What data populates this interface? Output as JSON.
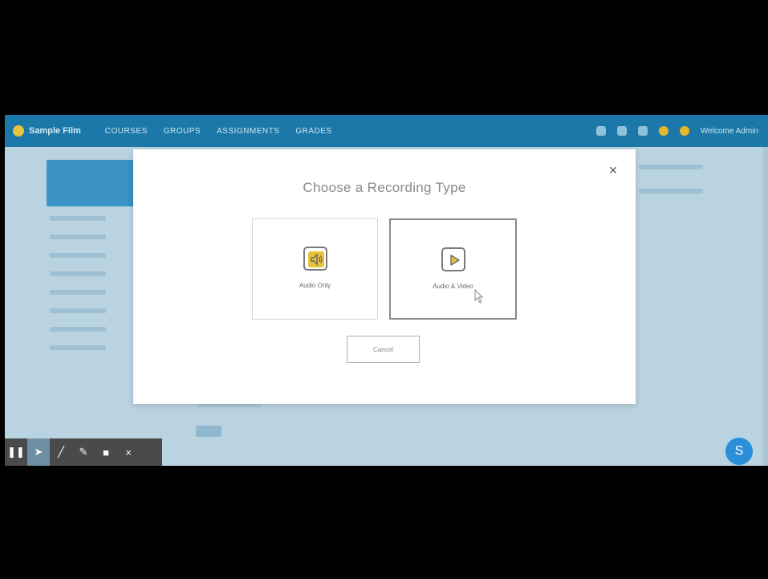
{
  "app": {
    "brand": "Sample Film",
    "nav_items": [
      "COURSES",
      "GROUPS",
      "ASSIGNMENTS",
      "GRADES"
    ],
    "user_label": "Welcome Admin"
  },
  "modal": {
    "title": "Choose a Recording Type",
    "close_symbol": "×",
    "options": [
      {
        "label": "Audio Only",
        "icon": "speaker-icon"
      },
      {
        "label": "Audio & Video",
        "icon": "play-icon"
      }
    ],
    "cancel_label": "Cancel"
  },
  "toolbar": {
    "tools": [
      {
        "name": "pause-icon",
        "glyph": "❚❚"
      },
      {
        "name": "pointer-icon",
        "glyph": "➤"
      },
      {
        "name": "pen-icon",
        "glyph": "╱"
      },
      {
        "name": "marker-icon",
        "glyph": "✎"
      },
      {
        "name": "camera-icon",
        "glyph": "■"
      },
      {
        "name": "close-icon",
        "glyph": "×"
      }
    ]
  },
  "badge": {
    "letter": "S"
  },
  "colors": {
    "nav": "#1b78a8",
    "accent_yellow": "#e8c33a",
    "badge_blue": "#2a8fd8"
  }
}
